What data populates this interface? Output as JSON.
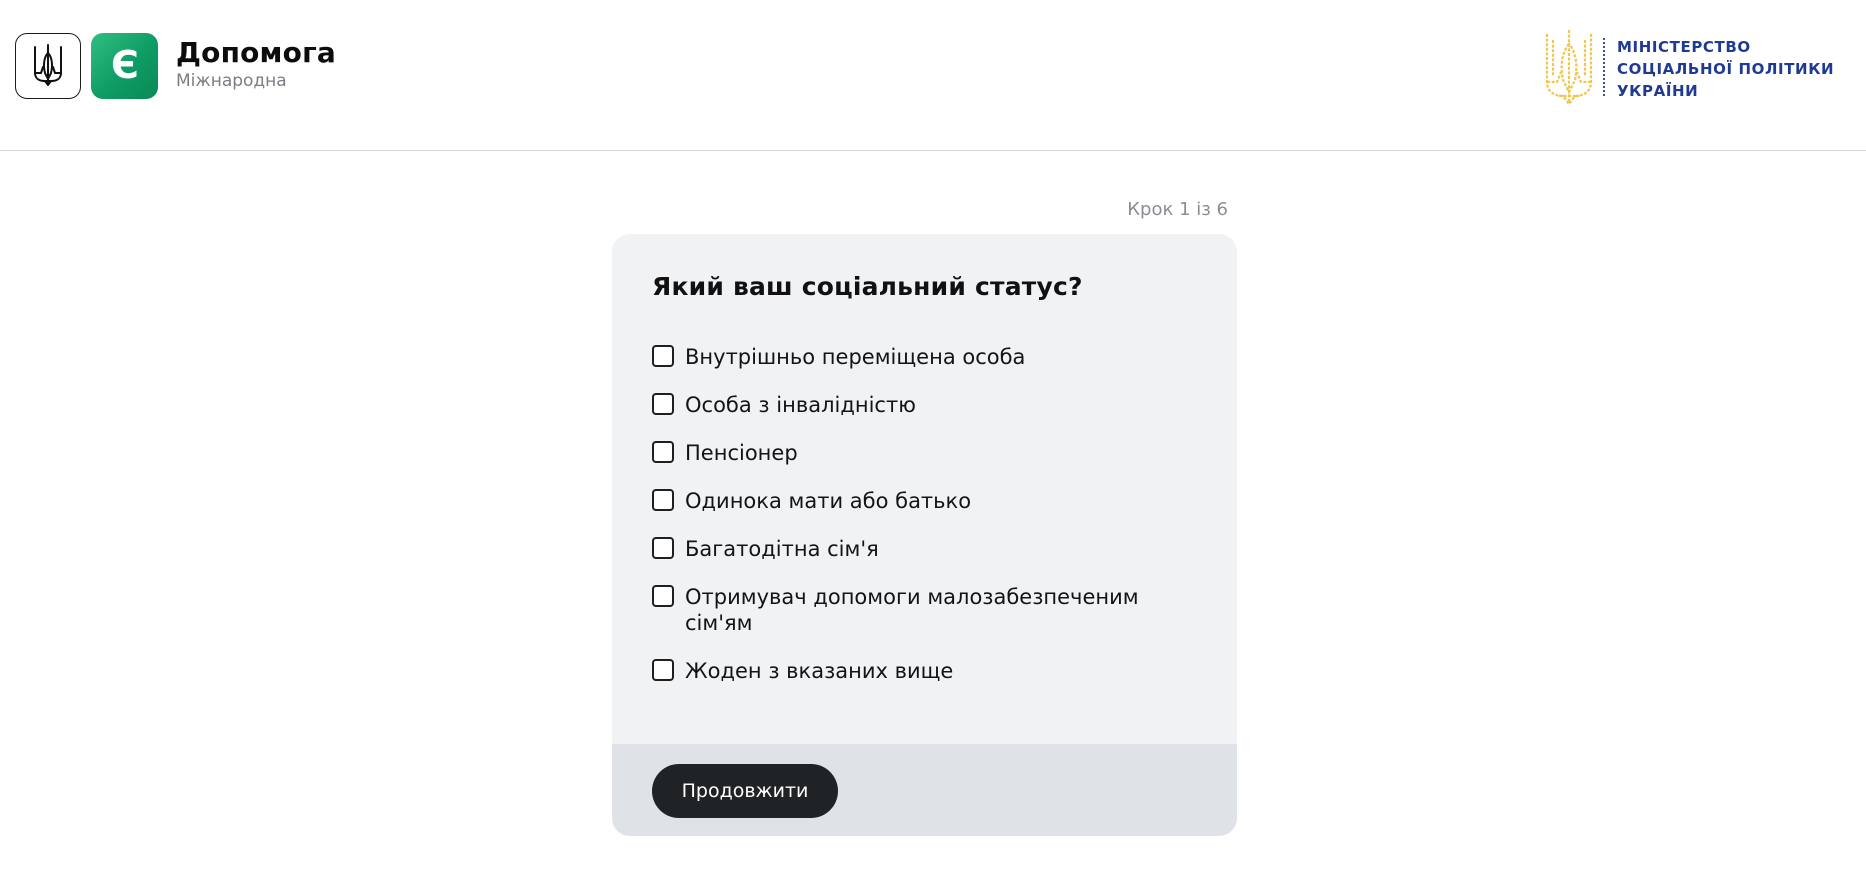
{
  "header": {
    "brand_title": "Допомога",
    "brand_subtitle": "Міжнародна",
    "app_icon_letter": "Є",
    "ministry_lines": [
      "МІНІСТЕРСТВО",
      "СОЦІАЛЬНОЇ ПОЛІТИКИ",
      "УКРАЇНИ"
    ]
  },
  "step": {
    "label": "Крок 1 із 6"
  },
  "form": {
    "question": "Який ваш соціальний статус?",
    "options": [
      {
        "label": "Внутрішньо переміщена особа",
        "checked": false
      },
      {
        "label": "Особа з інвалідністю",
        "checked": false
      },
      {
        "label": "Пенсіонер",
        "checked": false
      },
      {
        "label": "Одинока мати або батько",
        "checked": false
      },
      {
        "label": "Багатодітна сім'я",
        "checked": false
      },
      {
        "label": "Отримувач допомоги малозабезпеченим сім'ям",
        "checked": false
      },
      {
        "label": "Жоден з вказаних вище",
        "checked": false
      }
    ],
    "continue_label": "Продовжити"
  },
  "colors": {
    "app_green": "#0f9b64",
    "ministry_blue": "#1f3a93",
    "emblem_gold": "#f0c64e",
    "button_dark": "#202326",
    "card_bg": "#f1f2f4",
    "footer_bg": "#dfe2e6"
  },
  "icons": {
    "trident": "trident-icon",
    "app": "app-logo-icon",
    "ministry": "ministry-emblem-icon",
    "checkbox": "checkbox-icon"
  }
}
